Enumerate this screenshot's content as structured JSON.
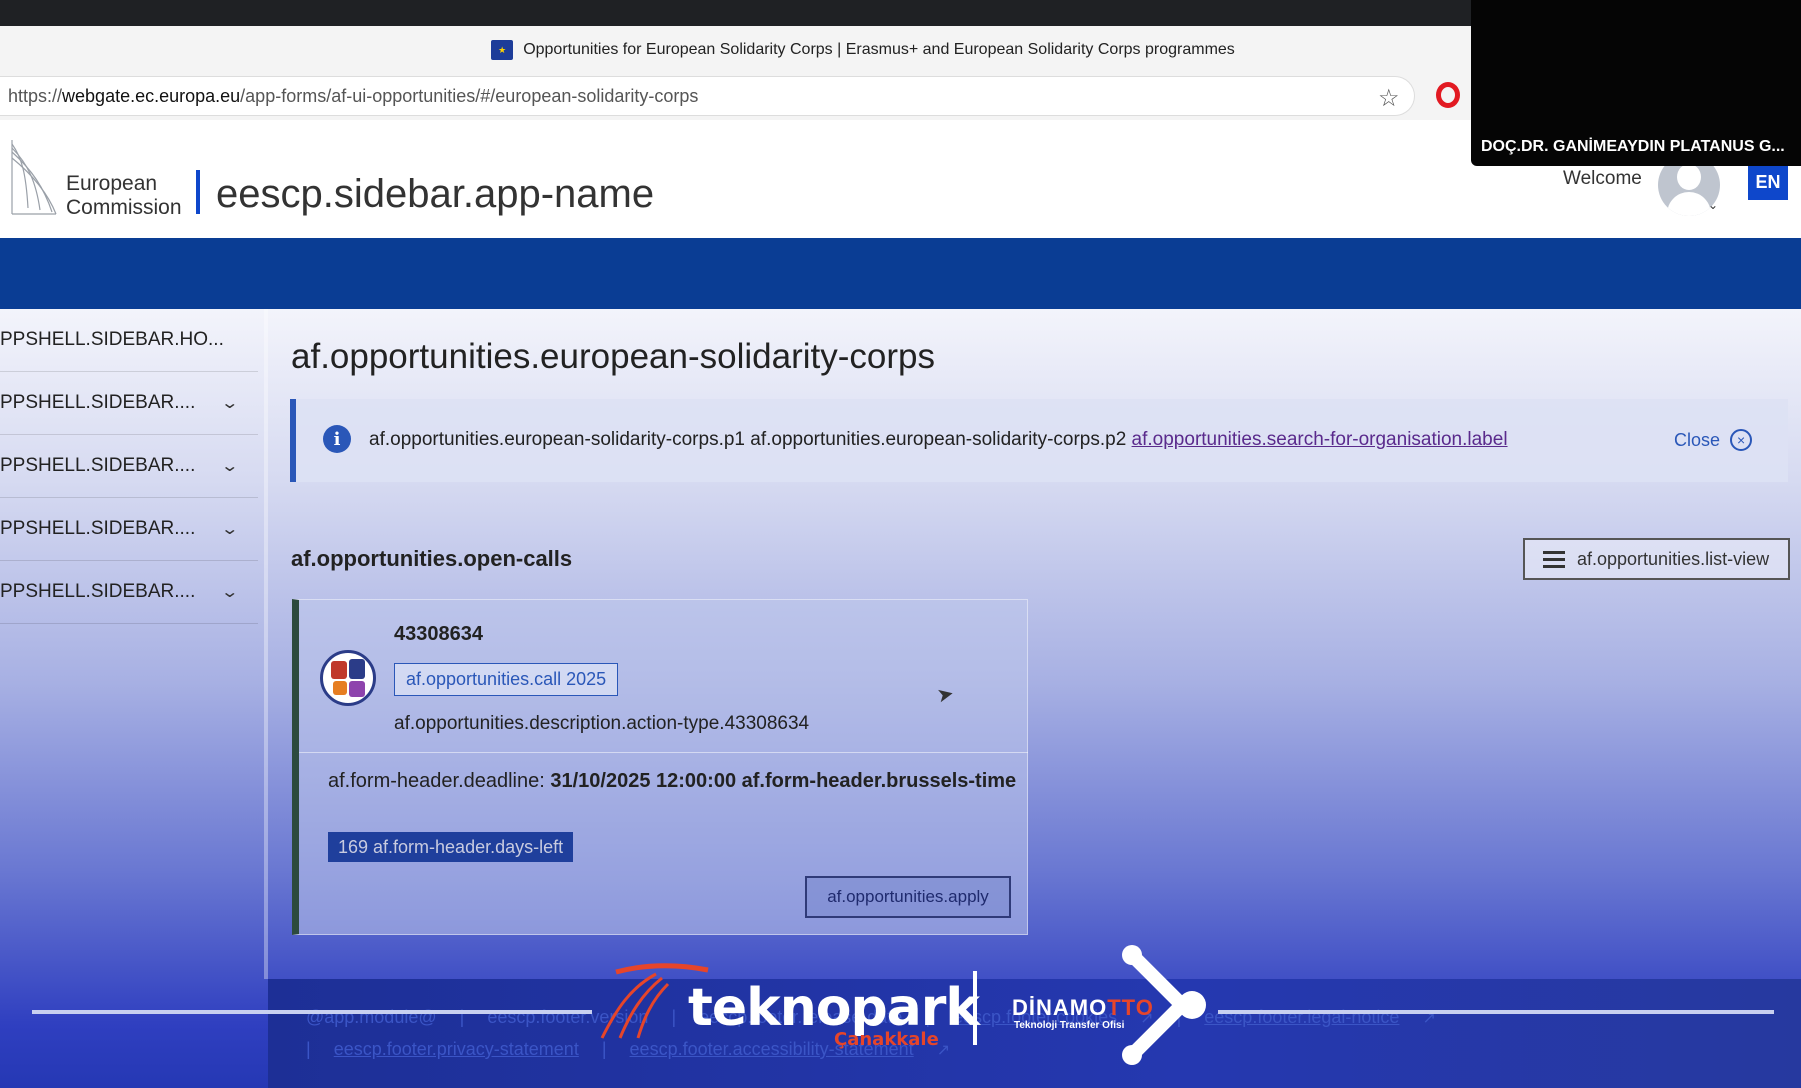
{
  "browser": {
    "tab_title": "Opportunities for European Solidarity Corps | Erasmus+ and European Solidarity Corps programmes",
    "url_prefix": "https://",
    "url_host": "webgate.ec.europa.eu",
    "url_path": "/app-forms/af-ui-opportunities/#/european-solidarity-corps"
  },
  "header": {
    "org_line1": "European",
    "org_line2": "Commission",
    "app_name": "eescp.sidebar.app-name",
    "welcome": "Welcome",
    "language": "EN"
  },
  "sidebar": {
    "items": [
      {
        "label": "PPSHELL.SIDEBAR.HO..."
      },
      {
        "label": "PPSHELL.SIDEBAR...."
      },
      {
        "label": "PPSHELL.SIDEBAR...."
      },
      {
        "label": "PPSHELL.SIDEBAR...."
      },
      {
        "label": "PPSHELL.SIDEBAR...."
      }
    ]
  },
  "main": {
    "title": "af.opportunities.european-solidarity-corps",
    "notice": {
      "text": "af.opportunities.european-solidarity-corps.p1 af.opportunities.european-solidarity-corps.p2",
      "link": "af.opportunities.search-for-organisation.label",
      "close": "Close"
    },
    "section_title": "af.opportunities.open-calls",
    "list_view_label": "af.opportunities.list-view",
    "call": {
      "id": "43308634",
      "tag": "af.opportunities.call 2025",
      "description": "af.opportunities.description.action-type.43308634",
      "deadline_label": "af.form-header.deadline:",
      "deadline_value": "31/10/2025 12:00:00 af.form-header.brussels-time",
      "days_left": "169 af.form-header.days-left",
      "apply_label": "af.opportunities.apply"
    }
  },
  "footer": {
    "module": "@app.module@",
    "version": "eescp.footer.version",
    "release": "eescp.footer.release-date",
    "cookies": "eescp.footer.cookies",
    "legal": "eescp.footer.legal-notice",
    "privacy": "eescp.footer.privacy-statement",
    "accessibility": "eescp.footer.accessibility-statement",
    "sep": "|"
  },
  "overlay": {
    "participant_name": "DOÇ.DR. GANİMEAYDIN PLATANUS G...",
    "watermark_brand": "teknopark",
    "watermark_city": "Çanakkale",
    "watermark_dinamo": "DİNAMO",
    "watermark_tto": "TTO",
    "watermark_subtitle": "Teknoloji Transfer Ofisi"
  },
  "colors": {
    "ec_blue": "#0e47cb",
    "band_blue": "#0a3d94",
    "accent_orange": "#e6452a"
  }
}
